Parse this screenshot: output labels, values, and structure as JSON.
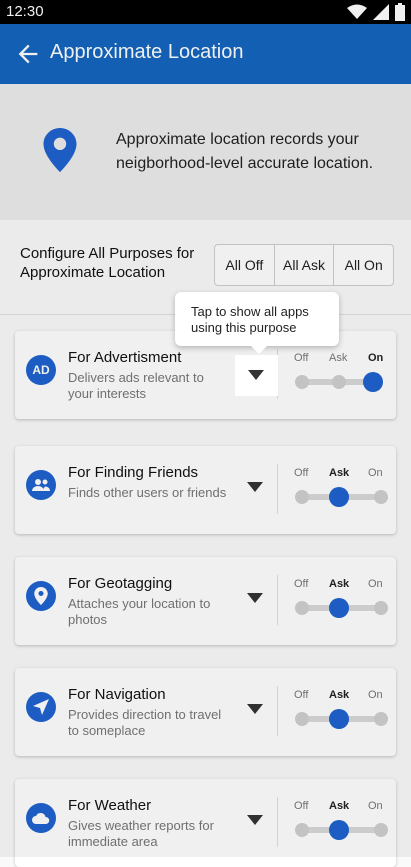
{
  "status_bar": {
    "time": "12:30",
    "icons": [
      "wifi-icon",
      "signal-icon",
      "battery-icon"
    ]
  },
  "app_bar": {
    "title": "Approximate Location",
    "back_icon": "arrow-back-icon"
  },
  "intro": {
    "icon": "location-pin-icon",
    "text": "Approximate location records your neigborhood-level accurate location."
  },
  "configure": {
    "label": "Configure All Purposes for Approximate Location",
    "options": [
      "All Off",
      "All Ask",
      "All On"
    ]
  },
  "tooltip": {
    "text": "Tap to show all apps using this purpose"
  },
  "purposes": [
    {
      "title": "For Advertisment",
      "description": "Delivers ads relevant to your interests",
      "icon": "ad-icon",
      "icon_text": "AD",
      "setting": "On"
    },
    {
      "title": "For Finding Friends",
      "description": "Finds other users or friends",
      "icon": "people-icon",
      "icon_text": "",
      "setting": "Ask"
    },
    {
      "title": "For Geotagging",
      "description": "Attaches your location to photos",
      "icon": "location-pin-icon",
      "icon_text": "",
      "setting": "Ask"
    },
    {
      "title": "For Navigation",
      "description": "Provides direction to travel to someplace",
      "icon": "navigation-arrow-icon",
      "icon_text": "",
      "setting": "Ask"
    },
    {
      "title": "For Weather",
      "description": "Gives weather reports for immediate area",
      "icon": "cloud-icon",
      "icon_text": "",
      "setting": "Ask"
    }
  ],
  "slider_labels": [
    "Off",
    "Ask",
    "On"
  ],
  "colors": {
    "primary": "#1565c0",
    "accent": "#1e62d0"
  }
}
